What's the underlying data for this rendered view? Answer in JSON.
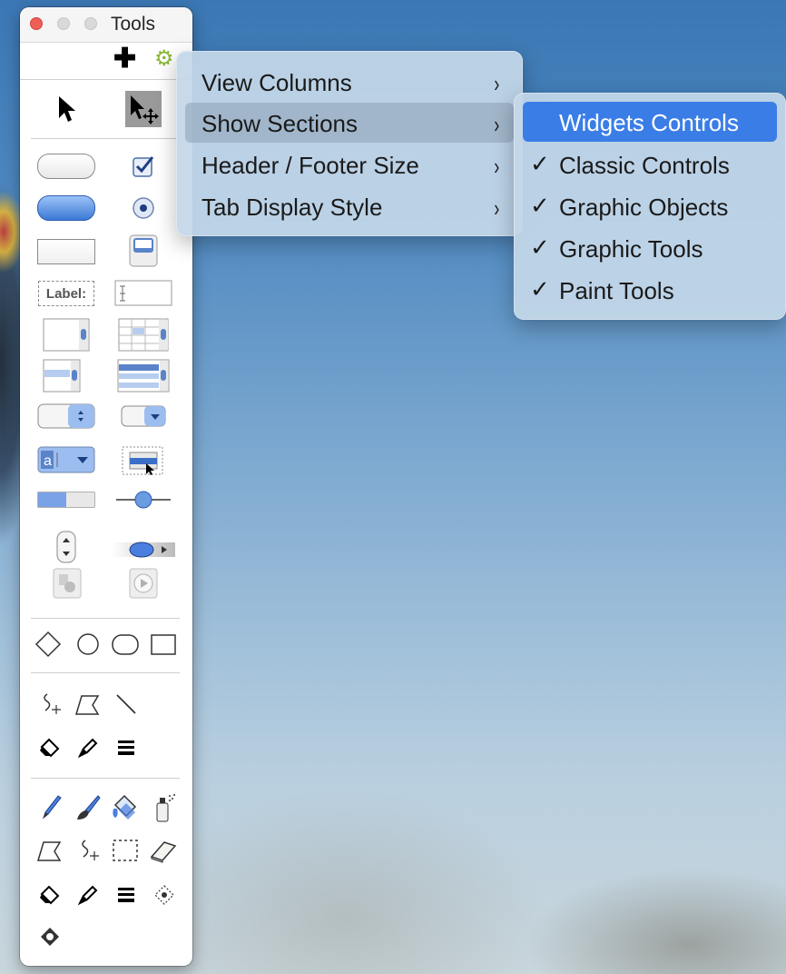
{
  "palette": {
    "title": "Tools",
    "add_label": "✚",
    "gear_label": "⚙",
    "widget_label_sample": "Label:"
  },
  "view_menu": {
    "items": [
      {
        "label": "View Columns",
        "arrow": "›"
      },
      {
        "label": "Show Sections",
        "arrow": "›"
      },
      {
        "label": "Header / Footer Size",
        "arrow": "›"
      },
      {
        "label": "Tab Display Style",
        "arrow": "›"
      }
    ]
  },
  "sections_menu": {
    "items": [
      {
        "label": "Widgets Controls",
        "check": ""
      },
      {
        "label": "Classic Controls",
        "check": "✓"
      },
      {
        "label": "Graphic Objects",
        "check": "✓"
      },
      {
        "label": "Graphic Tools",
        "check": "✓"
      },
      {
        "label": "Paint Tools",
        "check": "✓"
      }
    ]
  },
  "colors": {
    "accent": "#3a7de6",
    "gear": "#8bb83a",
    "close": "#ed5f57"
  }
}
